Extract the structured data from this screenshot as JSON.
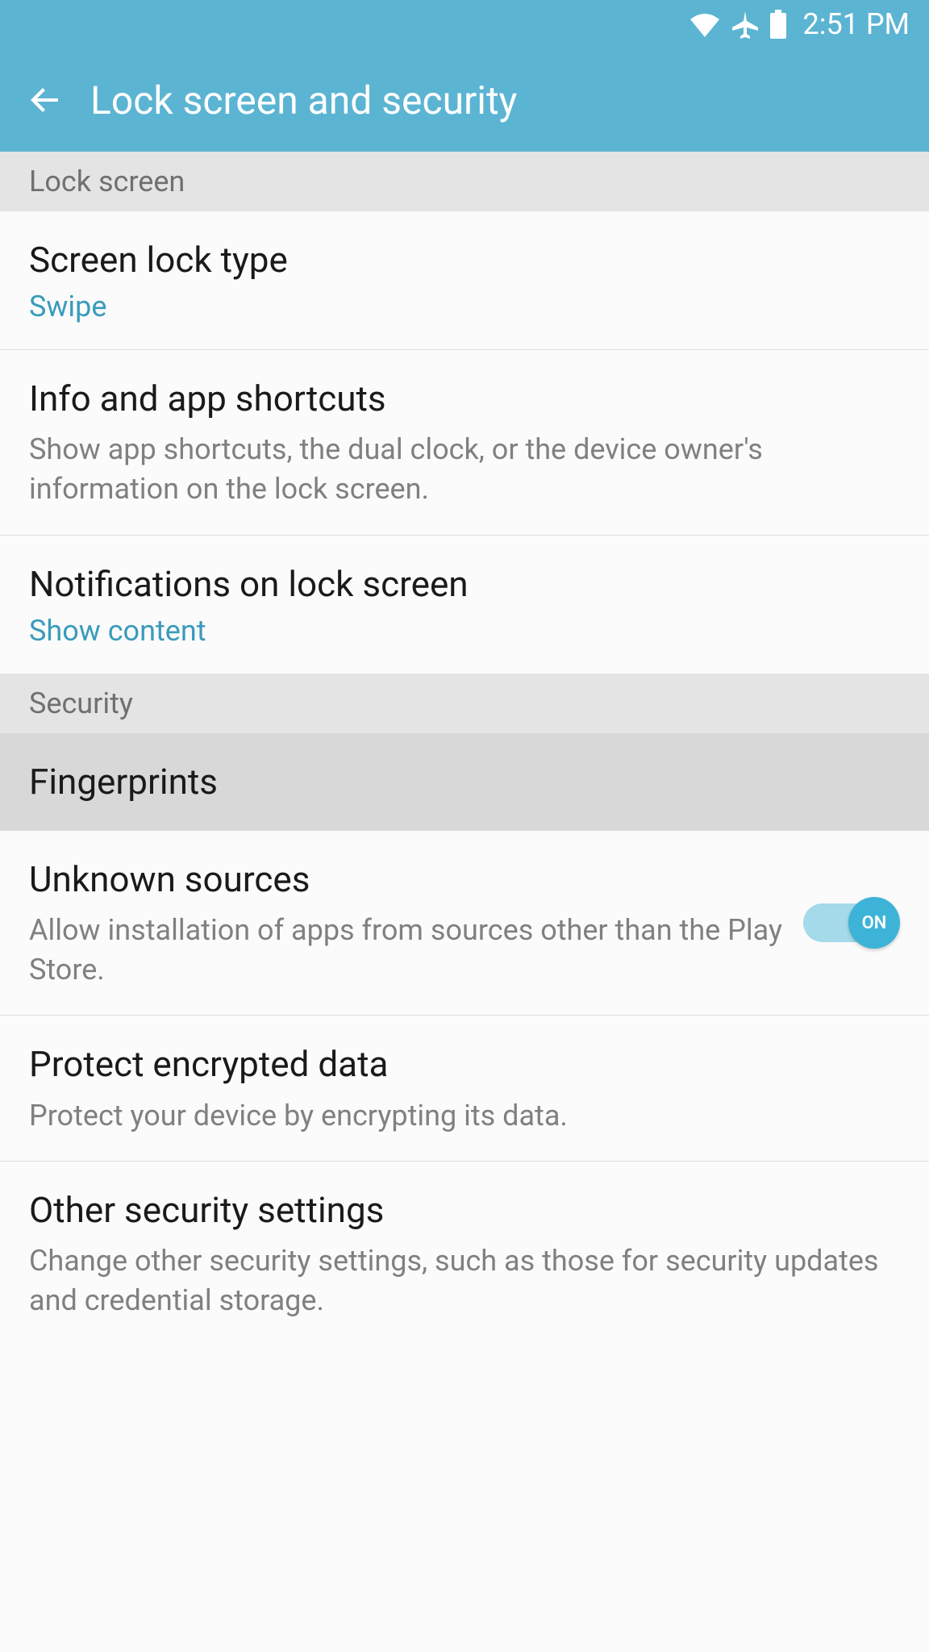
{
  "status_bar": {
    "time": "2:51 PM"
  },
  "header": {
    "title": "Lock screen and security"
  },
  "sections": {
    "lock_screen": {
      "header": "Lock screen",
      "items": {
        "screen_lock": {
          "title": "Screen lock type",
          "subtitle": "Swipe"
        },
        "info_shortcuts": {
          "title": "Info and app shortcuts",
          "description": "Show app shortcuts, the dual clock, or the device owner's information on the lock screen."
        },
        "notifications": {
          "title": "Notifications on lock screen",
          "subtitle": "Show content"
        }
      }
    },
    "security": {
      "header": "Security",
      "items": {
        "fingerprints": {
          "title": "Fingerprints"
        },
        "unknown_sources": {
          "title": "Unknown sources",
          "description": "Allow installation of apps from sources other than the Play Store.",
          "toggle_state": "ON"
        },
        "protect_encrypted": {
          "title": "Protect encrypted data",
          "description": "Protect your device by encrypting its data."
        },
        "other_security": {
          "title": "Other security settings",
          "description": "Change other security settings, such as those for security updates and credential storage."
        }
      }
    }
  }
}
